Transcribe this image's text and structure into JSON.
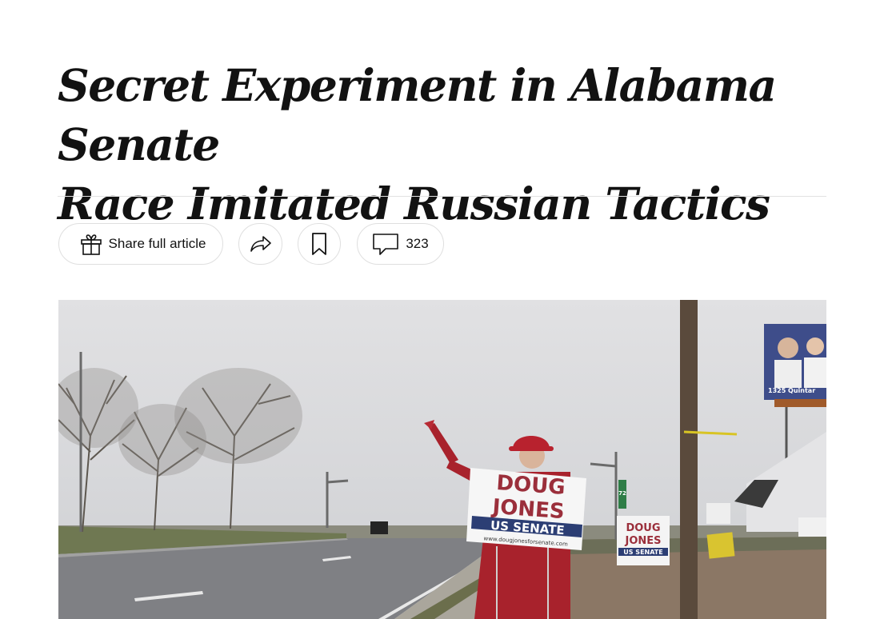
{
  "article": {
    "headline_line1": "Secret Experiment in Alabama Senate",
    "headline_line2": "Race Imitated Russian Tactics"
  },
  "toolbar": {
    "share_full_article_label": "Share full article",
    "comment_count": "323",
    "icons": {
      "gift": "gift-icon",
      "share": "share-arrow-icon",
      "save": "bookmark-icon",
      "comments": "comment-bubble-icon"
    }
  },
  "photo": {
    "sign_main_line1": "DOUG",
    "sign_main_line2": "JONES",
    "sign_main_band": "US SENATE",
    "sign_main_url": "www.dougjonesforsenate.com",
    "sign_small_line1": "DOUG",
    "sign_small_line2": "JONES",
    "sign_small_band": "US SENATE",
    "billboard_text": "1325 Quintar",
    "road_sign_number": "72",
    "colors": {
      "sign_red": "#9b2f3b",
      "sign_blue": "#2c3e74",
      "coat_red": "#a8222c",
      "sky": "#d9d9db"
    }
  }
}
